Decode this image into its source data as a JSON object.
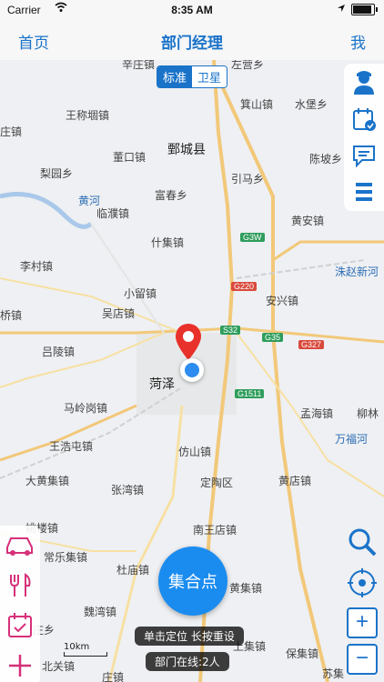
{
  "status": {
    "carrier": "Carrier",
    "time": "8:35 AM",
    "battery_level": 0.9
  },
  "nav": {
    "left": "首页",
    "title": "部门经理",
    "right": "我"
  },
  "map_type": {
    "standard": "标准",
    "satellite": "卫星"
  },
  "places": [
    {
      "id": "xinzhuang",
      "name": "辛庄镇"
    },
    {
      "id": "zuoying",
      "name": "左营乡"
    },
    {
      "id": "wangchengtuan",
      "name": "王称堌镇"
    },
    {
      "id": "jishan",
      "name": "箕山镇"
    },
    {
      "id": "shuibaoxiang",
      "name": "水堡乡"
    },
    {
      "id": "zhuang",
      "name": "庄镇"
    },
    {
      "id": "dongxiang",
      "name": "董口镇"
    },
    {
      "id": "juancheng",
      "name": "鄄城县"
    },
    {
      "id": "chenxiaxiang",
      "name": "陈坡乡"
    },
    {
      "id": "liyuan",
      "name": "梨园乡"
    },
    {
      "id": "yinma",
      "name": "引马乡"
    },
    {
      "id": "huanghe",
      "name": "黄河"
    },
    {
      "id": "fuchun",
      "name": "富春乡"
    },
    {
      "id": "linpu",
      "name": "临濮镇"
    },
    {
      "id": "huangan",
      "name": "黄安镇"
    },
    {
      "id": "shiji",
      "name": "什集镇"
    },
    {
      "id": "licun",
      "name": "李村镇"
    },
    {
      "id": "zhuzhao",
      "name": "洙赵新河"
    },
    {
      "id": "xiaoliu",
      "name": "小留镇"
    },
    {
      "id": "anxing",
      "name": "安兴镇"
    },
    {
      "id": "qiao",
      "name": "桥镇"
    },
    {
      "id": "wudian",
      "name": "吴店镇"
    },
    {
      "id": "lvling",
      "name": "吕陵镇"
    },
    {
      "id": "heze",
      "name": "菏泽"
    },
    {
      "id": "malinggang",
      "name": "马岭岗镇"
    },
    {
      "id": "menghai",
      "name": "孟海镇"
    },
    {
      "id": "liulin",
      "name": "柳林"
    },
    {
      "id": "wanfuhe",
      "name": "万福河"
    },
    {
      "id": "wangtun",
      "name": "王浩屯镇"
    },
    {
      "id": "fangshan",
      "name": "仿山镇"
    },
    {
      "id": "dahuangji",
      "name": "大黄集镇"
    },
    {
      "id": "zhangwan",
      "name": "张湾镇"
    },
    {
      "id": "dingtao",
      "name": "定陶区"
    },
    {
      "id": "huangdian",
      "name": "黄店镇"
    },
    {
      "id": "yaolou",
      "name": "姚楼镇"
    },
    {
      "id": "nanwangdian",
      "name": "南王店镇"
    },
    {
      "id": "changle",
      "name": "常乐集镇"
    },
    {
      "id": "dumiao",
      "name": "杜庙镇"
    },
    {
      "id": "huangji",
      "name": "黄集镇"
    },
    {
      "id": "weiwan",
      "name": "魏湾镇"
    },
    {
      "id": "zhuangxiang",
      "name": "庄乡"
    },
    {
      "id": "shangji",
      "name": "上集镇"
    },
    {
      "id": "baoji",
      "name": "保集镇"
    },
    {
      "id": "beiguan",
      "name": "北关镇"
    },
    {
      "id": "suji",
      "name": "苏集"
    },
    {
      "id": "zhuang2",
      "name": "庄镇"
    }
  ],
  "shields": [
    {
      "id": "g3w",
      "label": "G3W",
      "color": "green"
    },
    {
      "id": "g220",
      "label": "G220",
      "color": "red"
    },
    {
      "id": "s32",
      "label": "S32",
      "color": "green"
    },
    {
      "id": "g35",
      "label": "G35",
      "color": "green"
    },
    {
      "id": "g327",
      "label": "G327",
      "color": "red"
    },
    {
      "id": "g1511",
      "label": "G1511",
      "color": "green"
    }
  ],
  "gather_button": "集合点",
  "tips": {
    "locate": "单击定位  长按重设",
    "online": "部门在线:2人"
  },
  "scale_label": "10km",
  "colors": {
    "accent": "#1a73c9",
    "gather": "#1a8cf0",
    "left_tools": "#d6307a",
    "pin": "#e8312b"
  },
  "right_tools": [
    "person-icon",
    "calendar-check-icon",
    "message-icon",
    "menu-icon"
  ],
  "left_tools": [
    "car-icon",
    "restaurant-icon",
    "calendar-icon",
    "add-icon"
  ]
}
